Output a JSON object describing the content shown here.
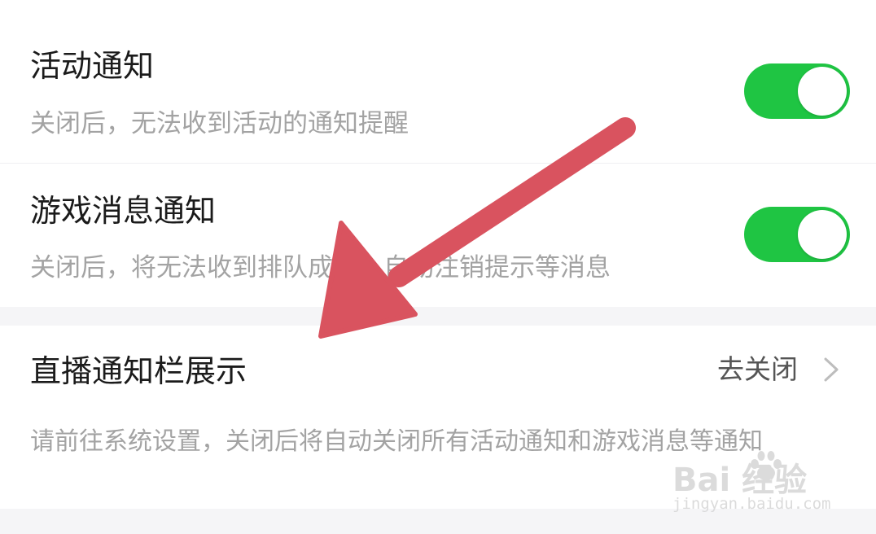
{
  "settings": {
    "activity_notification": {
      "title": "活动通知",
      "description": "关闭后，无法收到活动的通知提醒",
      "enabled": true
    },
    "game_message_notification": {
      "title": "游戏消息通知",
      "description": "关闭后，将无法收到排队成功、自动注销提示等消息",
      "enabled": true
    },
    "live_notification_bar": {
      "title": "直播通知栏展示",
      "action_label": "去关闭",
      "description": "请前往系统设置，关闭后将自动关闭所有活动通知和游戏消息等通知"
    }
  },
  "watermark": {
    "main": "Bai  经验",
    "sub": "jingyan.baidu.com"
  },
  "colors": {
    "toggle_on": "#1fc543",
    "annotation_arrow": "#d9535f",
    "background": "#f5f5f7"
  },
  "icons": {
    "chevron": "chevron-right-icon",
    "annotation": "red-arrow-annotation"
  }
}
